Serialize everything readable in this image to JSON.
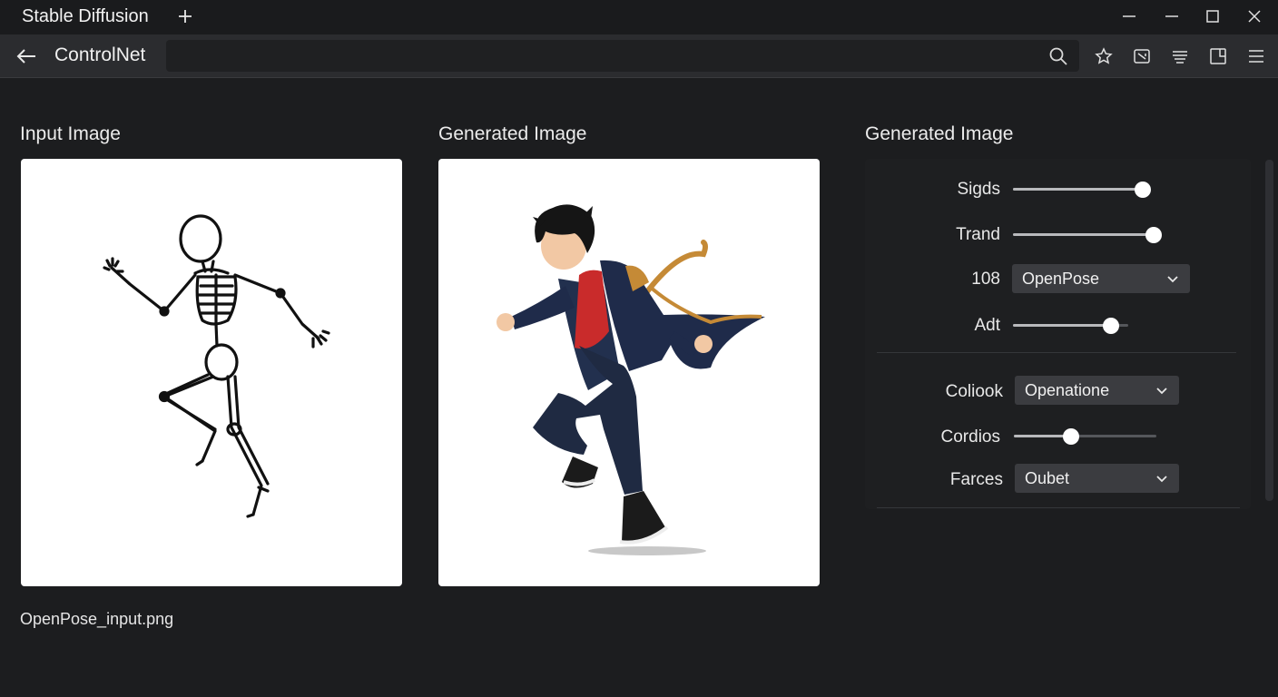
{
  "titlebar": {
    "app_title": "Stable Diffusion"
  },
  "navbar": {
    "title": "ControlNet",
    "search_value": ""
  },
  "panels": {
    "input_title": "Input Image",
    "generated_title": "Generated Image",
    "settings_title": "Generated Image",
    "input_filename": "OpenPose_input.png"
  },
  "settings": {
    "rows": [
      {
        "label": "Sigds",
        "type": "slider",
        "value": 0.98
      },
      {
        "label": "Trand",
        "type": "slider",
        "value": 1.0
      },
      {
        "label": "108",
        "type": "select",
        "value": "OpenPose"
      },
      {
        "label": "Adt",
        "type": "slider",
        "value": 0.85
      },
      {
        "label": "Coliook",
        "type": "select",
        "value": "Openatione"
      },
      {
        "label": "Cordios",
        "type": "slider",
        "value": 0.4
      },
      {
        "label": "Farces",
        "type": "select",
        "value": "Oubet"
      }
    ]
  },
  "icons": [
    "plus-icon",
    "minimize-icon",
    "maximize-icon",
    "close-icon",
    "back-arrow-icon",
    "search-icon",
    "star-icon",
    "screenshot-icon",
    "reader-icon",
    "split-view-icon",
    "menu-icon",
    "chevron-down-icon"
  ],
  "colors": {
    "background": "#1c1d1f",
    "navbar": "#2b2c2f",
    "dropdown": "#3b3c40",
    "slider_thumb": "#ffffff"
  }
}
